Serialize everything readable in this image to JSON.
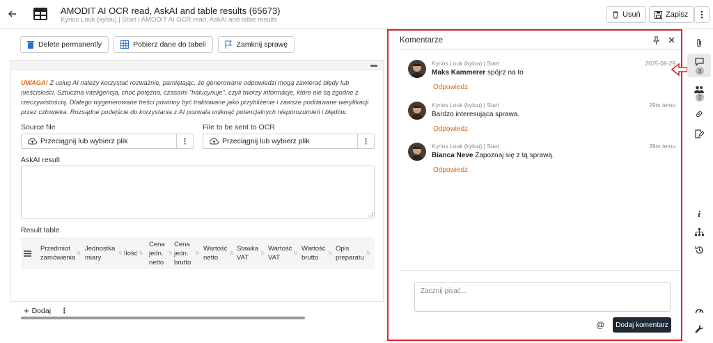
{
  "header": {
    "title": "AMODIT AI OCR read, AskAI and table results (65673)",
    "subtitle": "Kyrios Louk (kylou) | Start | AMODIT AI OCR read, AskAI and table results",
    "delete_label": "Usuń",
    "save_label": "Zapisz"
  },
  "toolbar": {
    "delete_permanently": "Delete permanently",
    "fetch_table": "Pobierz dane do tabeli",
    "close_case": "Zamknij sprawę"
  },
  "form": {
    "warning_prefix": "UWAGA!",
    "warning_text": " Z usług AI należy korzystać rozważnie, pamiętając, że generowane odpowiedzi mogą zawierać błędy lub nieścisłości. Sztuczna inteligencja, choć potężna, czasami \"halucynuje\", czyli tworzy informacje, które nie są zgodne z rzeczywistością. Dlatego wygenerowane treści powinny być traktowane jako przybliżenie i zawsze poddawane weryfikacji przez człowieka. Rozsądne podejście do korzystania z AI pozwala uniknąć potencjalnych nieporozumień i błędów.",
    "source_file_label": "Source file",
    "ocr_file_label": "File to be sent to OCR",
    "drop_placeholder": "Przeciągnij lub wybierz plik",
    "askai_label": "AskAI result",
    "result_table_label": "Result table",
    "columns": [
      "Przedmiot zamówienia",
      "Jednostka miary",
      "Ilość",
      "Cena jedn. netto",
      "Cena jedn. brutto",
      "Wartość netto",
      "Stawka VAT",
      "Wartość VAT",
      "Wartość brutto",
      "Opis preparatu"
    ],
    "add_label": "Dodaj"
  },
  "comments": {
    "title": "Komentarze",
    "items": [
      {
        "author": "Kyrios Louk (kylou) | Start",
        "time": "2025-08-29",
        "mention": "Maks Kammerer",
        "text": " spójrz na to",
        "reply": "Odpowiedz"
      },
      {
        "author": "Kyrios Louk (kylou) | Start",
        "time": "29m temu",
        "mention": "",
        "text": "Bardzo interesująca sprawa.",
        "reply": "Odpowiedz"
      },
      {
        "author": "Kyrios Louk (kylou) | Start",
        "time": "28m temu",
        "mention": "Bianca Neve",
        "text": " Zapoznaj się z tą sprawą.",
        "reply": "Odpowiedz"
      }
    ],
    "input_placeholder": "Zacznij pisać...",
    "mention_symbol": "@",
    "submit_label": "Dodaj komentarz"
  },
  "sidebar": {
    "comments_count": "3",
    "users_count": "2",
    "info_glyph": "i"
  },
  "colors": {
    "accent": "#e0661b",
    "highlight": "#e0262b",
    "dark": "#1e2a35"
  }
}
